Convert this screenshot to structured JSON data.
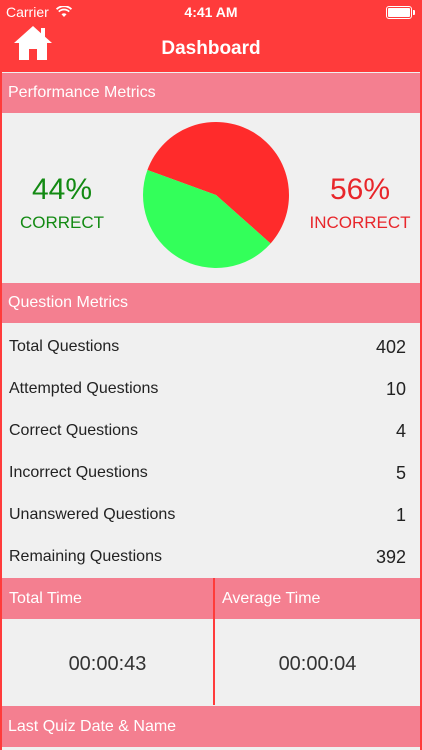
{
  "status_bar": {
    "carrier": "Carrier",
    "time": "4:41 AM"
  },
  "header": {
    "title": "Dashboard"
  },
  "performance": {
    "title": "Performance Metrics",
    "correct_percent": "44%",
    "correct_label": "CORRECT",
    "incorrect_percent": "56%",
    "incorrect_label": "INCORRECT",
    "pie": {
      "correct_fraction": 0.44,
      "incorrect_fraction": 0.56,
      "correct_color": "#33ff5a",
      "incorrect_color": "#ff2b2b"
    }
  },
  "questions": {
    "title": "Question Metrics",
    "rows": [
      {
        "label": "Total Questions",
        "value": "402"
      },
      {
        "label": "Attempted Questions",
        "value": "10"
      },
      {
        "label": "Correct Questions",
        "value": "4"
      },
      {
        "label": "Incorrect Questions",
        "value": "5"
      },
      {
        "label": "Unanswered Questions",
        "value": "1"
      },
      {
        "label": "Remaining Questions",
        "value": "392"
      }
    ]
  },
  "time": {
    "total_title": "Total Time",
    "total_value": "00:00:43",
    "average_title": "Average Time",
    "average_value": "00:00:04"
  },
  "last_quiz": {
    "title": "Last Quiz Date & Name"
  },
  "colors": {
    "accent": "#ff3b3b",
    "section": "#f47f90"
  }
}
